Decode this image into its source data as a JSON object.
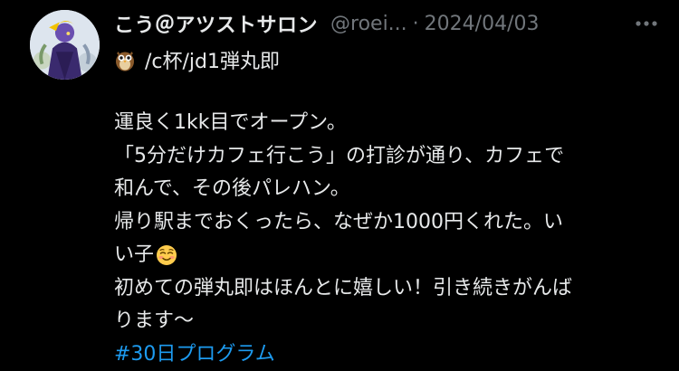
{
  "author": {
    "display_name": "こう＠アツストサロン",
    "handle": "@roei...",
    "separator": "·",
    "date": "2024/04/03",
    "bio_line": "/c杯/jd1弾丸即",
    "bio_icon": "owl-icon",
    "avatar": "avatar-illustration"
  },
  "tweet": {
    "lines": [
      "運良く1kk目でオープン。",
      "「5分だけカフェ行こう」の打診が通り、カフェで",
      "和んで、その後パレハン。",
      "帰り駅までおくったら、なぜか1000円くれた。い",
      "い子",
      "初めての弾丸即はほんとに嬉しい！引き続きがんば",
      "ります〜"
    ],
    "inline_emoji": "smiling-face-icon",
    "hashtag": "#30日プログラム"
  },
  "actions": {
    "more_icon": "more-options-icon"
  },
  "colors": {
    "background": "#000000",
    "text": "#e7e9ea",
    "muted": "#71767b",
    "link": "#1d9bf0"
  }
}
